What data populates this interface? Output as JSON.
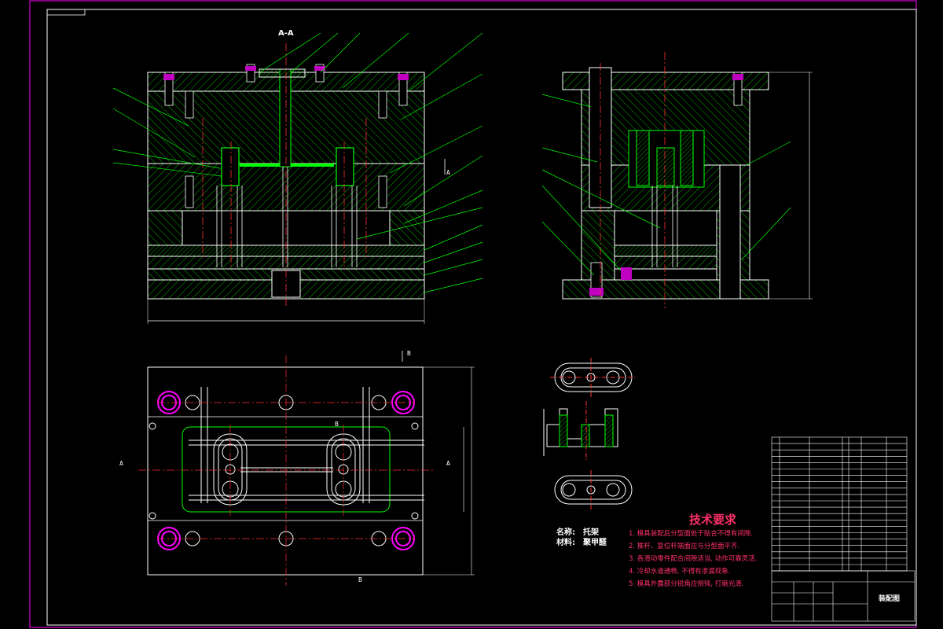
{
  "drawing": {
    "section_label_aa": "A-A",
    "section_marks": {
      "a": "A",
      "b": "B"
    },
    "tech_req_title": "技术要求",
    "tech_req_lines": [
      "1. 模具装配后分型面处于贴合不得有间隙.",
      "2. 推杆、复位杆端面应与分型面平齐.",
      "3. 各滑动零件配合间隙适当, 动作可靠灵活.",
      "4. 冷却水道通畅, 不得有渗漏现象.",
      "5. 模具外露部分锐角应倒钝, 打磨光滑."
    ],
    "part_name_label": "名称:",
    "part_name": "托架",
    "material_label": "材料:",
    "material": "聚甲醛",
    "title_block_name": "装配图"
  },
  "colors": {
    "bg": "#000000",
    "border": "#ff00ff",
    "outline": "#ffffff",
    "hatch": "#00d000",
    "center": "#ff3030",
    "insert": "#c000c0",
    "dim": "#ffffff"
  }
}
